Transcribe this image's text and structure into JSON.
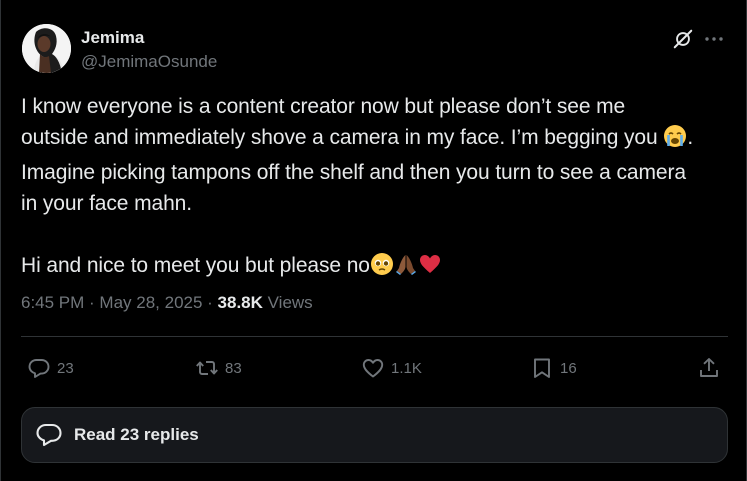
{
  "author": {
    "name": "Jemima",
    "handle": "@JemimaOsunde"
  },
  "tweet": {
    "text_part1": "I know everyone is a content creator now but please don’t see me\noutside and immediately shove a camera in my face. I’m begging you ",
    "text_part2": ".\nImagine picking tampons off the shelf and then you turn to see a camera\nin your face mahn.\n\nHi and nice to meet you but please no",
    "emojis": [
      "loudly-crying-face",
      "pleading-face",
      "folded-hands-medium-dark-skin",
      "red-heart"
    ]
  },
  "meta": {
    "time": "6:45 PM",
    "sep1": " · ",
    "date": "May 28, 2025",
    "sep2": " · ",
    "views_count": "38.8K",
    "views_label": " Views"
  },
  "actions": {
    "reply_count": "23",
    "retweet_count": "83",
    "like_count": "1.1K",
    "bookmark_count": "16"
  },
  "replies_button": {
    "label": "Read 23 replies"
  },
  "icons": {
    "header": [
      "grok-icon",
      "more-icon"
    ],
    "actions": [
      "reply-icon",
      "retweet-icon",
      "like-icon",
      "bookmark-icon",
      "share-icon"
    ],
    "pill": "speech-bubble-icon"
  },
  "colors": {
    "background": "#000000",
    "text": "#e7e9ea",
    "muted": "#71767b",
    "border": "#2f3336",
    "heart": "#dd2e44"
  }
}
